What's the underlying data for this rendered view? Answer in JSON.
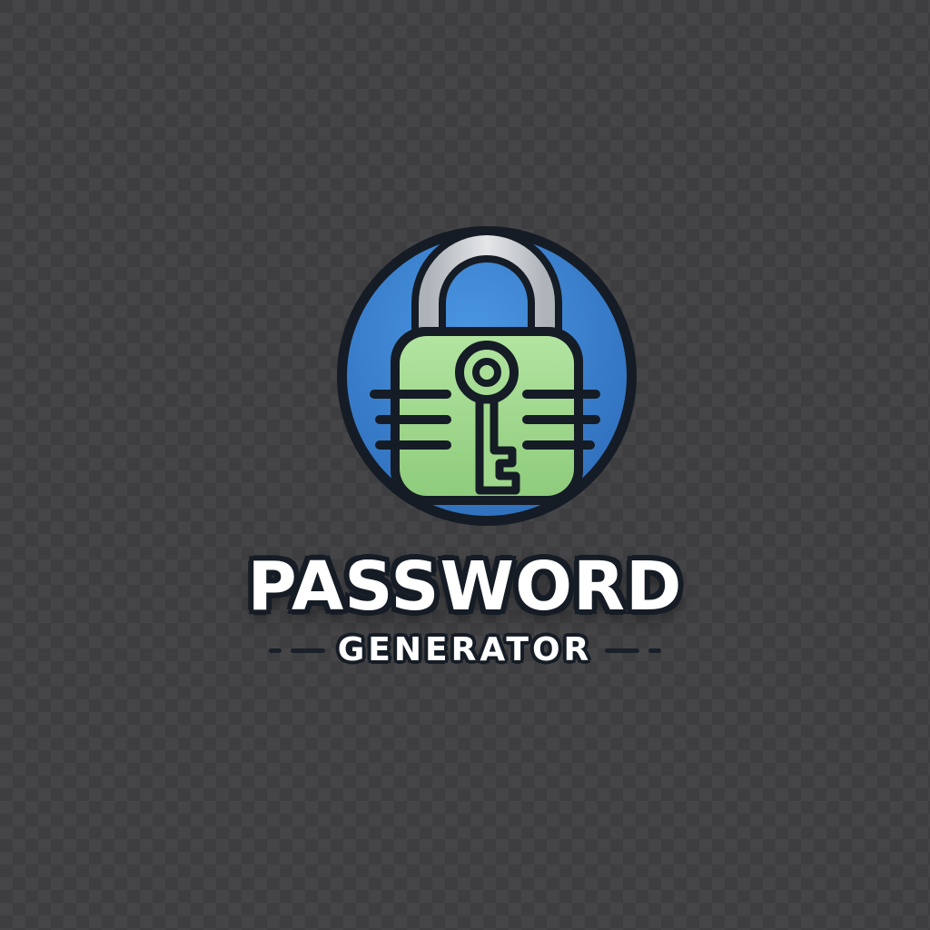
{
  "logo": {
    "title": "PASSWORD",
    "subtitle": "GENERATOR",
    "icon": "padlock-with-key-icon"
  },
  "colors": {
    "background": "#3e3e40",
    "circle_fill": "#3f86d4",
    "lock_body": "#9fd88c",
    "shackle": "#c9ccd0",
    "outline": "#151c25",
    "text": "#ffffff"
  }
}
